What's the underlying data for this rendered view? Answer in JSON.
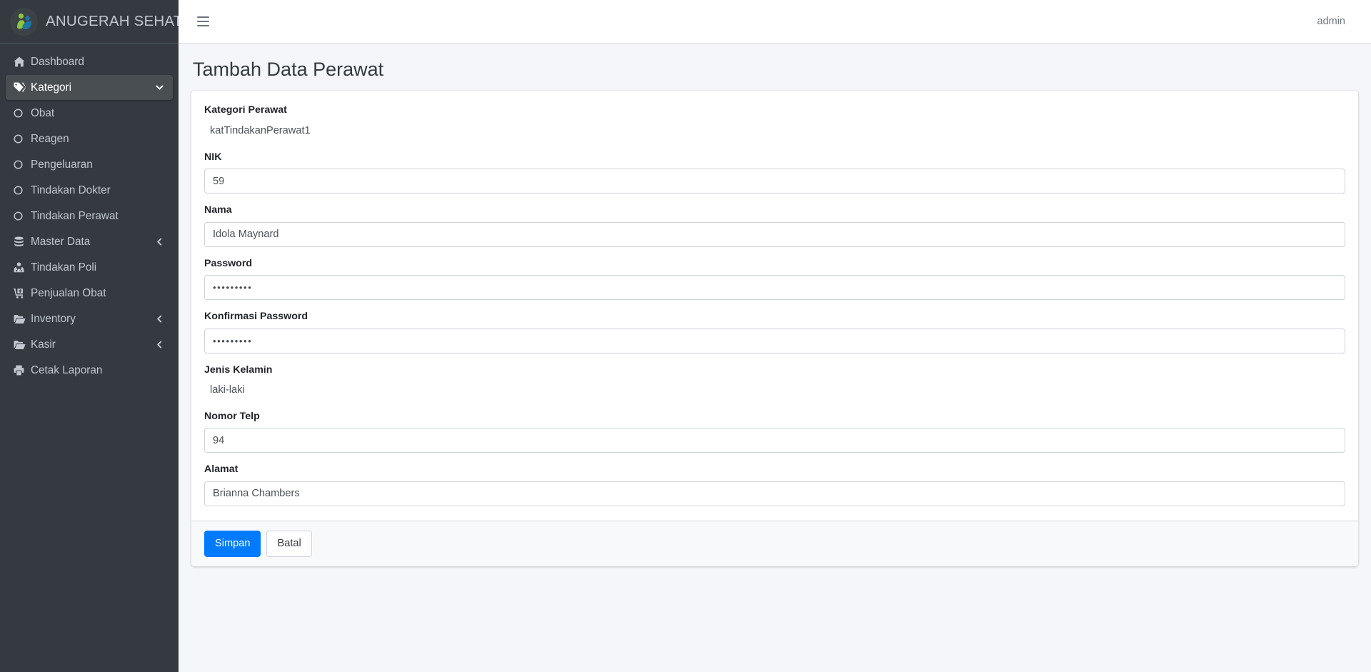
{
  "brand": {
    "name": "ANUGERAH SEHAT",
    "logo_icon": "people-health-logo-icon"
  },
  "topbar": {
    "menu_toggle_icon": "hamburger-menu-icon",
    "user_label": "admin"
  },
  "page": {
    "title": "Tambah Data Perawat"
  },
  "sidebar": {
    "items": [
      {
        "label": "Dashboard",
        "icon": "home-icon",
        "type": "link",
        "active": false
      },
      {
        "label": "Kategori",
        "icon": "tag-icon",
        "type": "treeview",
        "active": true,
        "arrow": "chevron-down-icon"
      },
      {
        "label": "Obat",
        "icon": "circle-icon",
        "type": "sub"
      },
      {
        "label": "Reagen",
        "icon": "circle-icon",
        "type": "sub"
      },
      {
        "label": "Pengeluaran",
        "icon": "circle-icon",
        "type": "sub"
      },
      {
        "label": "Tindakan Dokter",
        "icon": "circle-icon",
        "type": "sub"
      },
      {
        "label": "Tindakan Perawat",
        "icon": "circle-icon",
        "type": "sub"
      },
      {
        "label": "Master Data",
        "icon": "database-icon",
        "type": "treeview",
        "active": false,
        "arrow": "chevron-left-icon"
      },
      {
        "label": "Tindakan Poli",
        "icon": "user-md-icon",
        "type": "link",
        "active": false
      },
      {
        "label": "Penjualan Obat",
        "icon": "cart-plus-icon",
        "type": "link",
        "active": false
      },
      {
        "label": "Inventory",
        "icon": "folder-open-icon",
        "type": "treeview",
        "active": false,
        "arrow": "chevron-left-icon"
      },
      {
        "label": "Kasir",
        "icon": "folder-open-icon",
        "type": "treeview",
        "active": false,
        "arrow": "chevron-left-icon"
      },
      {
        "label": "Cetak Laporan",
        "icon": "print-icon",
        "type": "link",
        "active": false
      }
    ]
  },
  "form": {
    "fields": [
      {
        "label": "Kategori Perawat",
        "kind": "static",
        "value": "katTindakanPerawat1"
      },
      {
        "label": "NIK",
        "kind": "input",
        "value": "59",
        "placeholder": "59"
      },
      {
        "label": "Nama",
        "kind": "input",
        "value": "Idola Maynard",
        "placeholder": "Idola Maynard"
      },
      {
        "label": "Password",
        "kind": "password",
        "value": "•••••••••",
        "placeholder": ""
      },
      {
        "label": "Konfirmasi Password",
        "kind": "password",
        "value": "•••••••••",
        "placeholder": ""
      },
      {
        "label": "Jenis Kelamin",
        "kind": "static",
        "value": "laki-laki"
      },
      {
        "label": "Nomor Telp",
        "kind": "input",
        "value": "94",
        "placeholder": "94"
      },
      {
        "label": "Alamat",
        "kind": "input",
        "value": "Brianna Chambers",
        "placeholder": "Brianna Chambers"
      }
    ],
    "buttons": {
      "submit": "Simpan",
      "cancel": "Batal"
    }
  },
  "colors": {
    "sidebar_bg": "#343a40",
    "sidebar_active_bg": "#494e53",
    "primary": "#007bff",
    "content_bg": "#f4f6f9",
    "card_footer_bg": "#f8f9fa",
    "brand_text": "#c2c7d0"
  }
}
